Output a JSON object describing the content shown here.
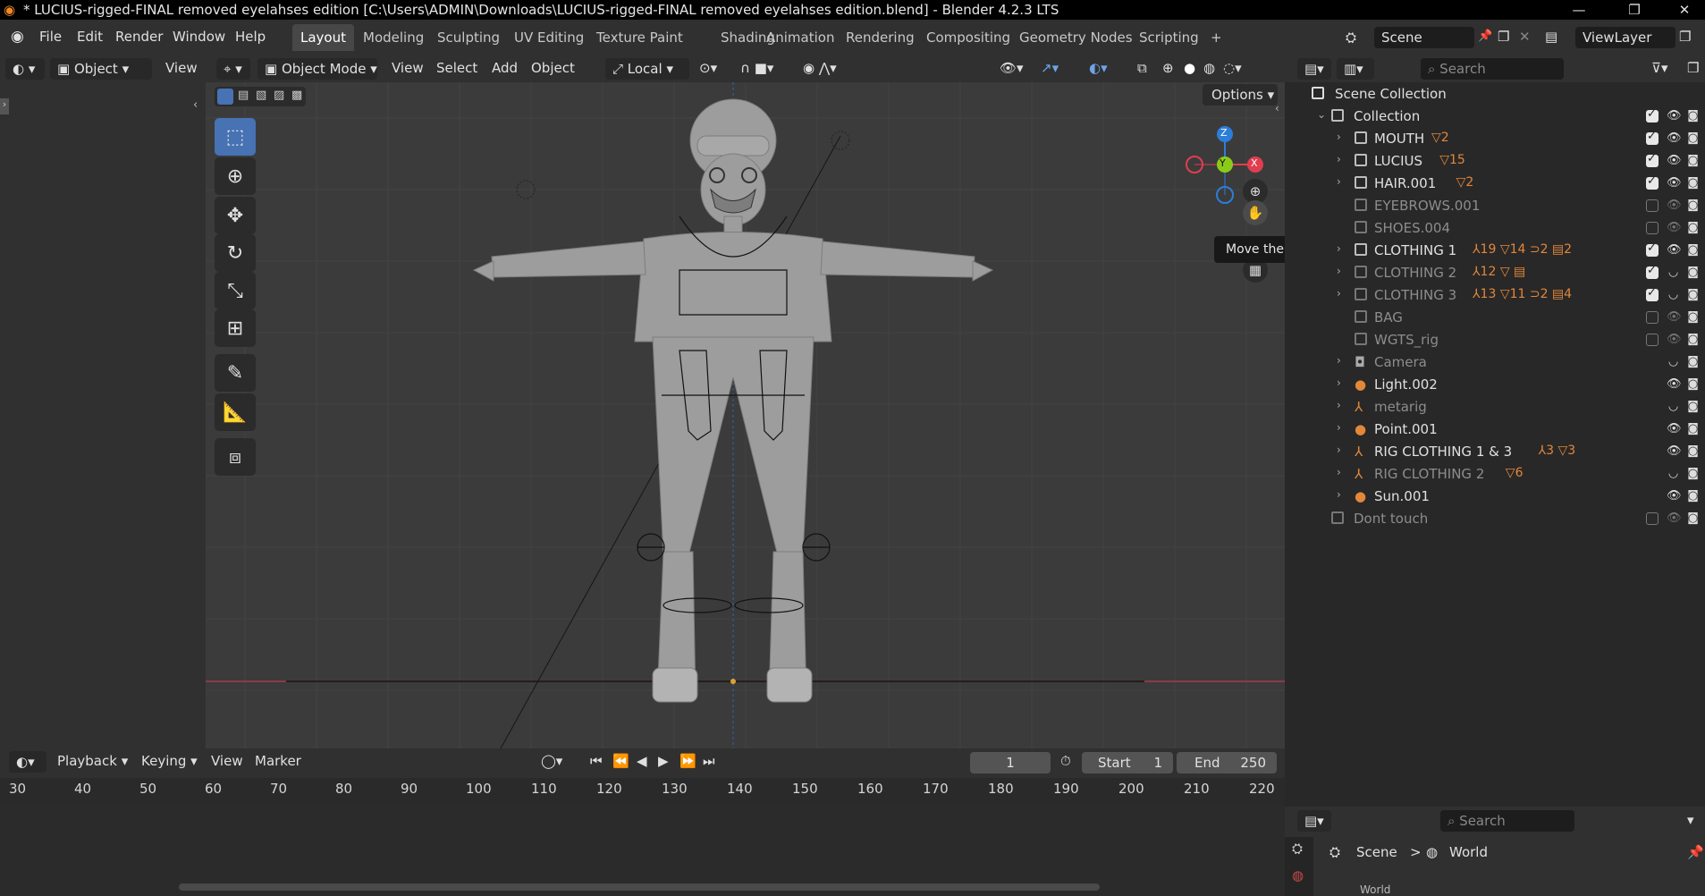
{
  "window": {
    "title": "* LUCIUS-rigged-FINAL removed eyelahses edition [C:\\Users\\ADMIN\\Downloads\\LUCIUS-rigged-FINAL removed eyelahses edition.blend] - Blender 4.2.3 LTS",
    "controls": {
      "minimize": "—",
      "maximize": "❐",
      "close": "✕"
    }
  },
  "menubar": {
    "items": [
      "File",
      "Edit",
      "Render",
      "Window",
      "Help"
    ],
    "workspaces": [
      "Layout",
      "Modeling",
      "Sculpting",
      "UV Editing",
      "Texture Paint",
      "Shading",
      "Animation",
      "Rendering",
      "Compositing",
      "Geometry Nodes",
      "Scripting"
    ],
    "active_workspace": "Layout",
    "add_tab": "+",
    "scene": "Scene",
    "view_layer": "ViewLayer"
  },
  "left_panel": {
    "mode_dropdown": "Object",
    "view_menu": "View"
  },
  "viewport_header": {
    "mode": "Object Mode",
    "menus": [
      "View",
      "Select",
      "Add",
      "Object"
    ],
    "transform_orientation": "Local",
    "options_label": "Options"
  },
  "viewport": {
    "tooltip": "Move the view",
    "gizmo_axes": {
      "z": "Z",
      "y": "Y",
      "x": "X"
    },
    "colors": {
      "x_axis": "#e03e50",
      "y_axis": "#8acb1a",
      "z_axis": "#2d7ed8",
      "active_tool": "#4772b3"
    }
  },
  "outliner": {
    "search_placeholder": "Search",
    "root": "Scene Collection",
    "collection": "Collection",
    "rows": [
      {
        "name": "MOUTH",
        "extra": "▽2",
        "dim": false,
        "checked": true
      },
      {
        "name": "LUCIUS",
        "extra": "▽15",
        "dim": false,
        "checked": true
      },
      {
        "name": "HAIR.001",
        "extra": "▽2",
        "dim": false,
        "checked": true
      },
      {
        "name": "EYEBROWS.001",
        "extra": "",
        "dim": true,
        "checked": false
      },
      {
        "name": "SHOES.004",
        "extra": "",
        "dim": true,
        "checked": false
      },
      {
        "name": "CLOTHING 1",
        "extra": "⅄19 ▽14 ⊃2 ▤2",
        "dim": false,
        "checked": true
      },
      {
        "name": "CLOTHING 2",
        "extra": "⅄12 ▽ ▤",
        "dim": true,
        "checked": true
      },
      {
        "name": "CLOTHING 3",
        "extra": "⅄13 ▽11 ⊃2 ▤4",
        "dim": true,
        "checked": true
      },
      {
        "name": "BAG",
        "extra": "",
        "dim": true,
        "checked": false
      },
      {
        "name": "WGTS_rig",
        "extra": "",
        "dim": true,
        "checked": false
      },
      {
        "name": "Camera",
        "extra": "",
        "dim": true,
        "checked": null
      },
      {
        "name": "Light.002",
        "extra": "",
        "dim": false,
        "checked": null
      },
      {
        "name": "metarig",
        "extra": "",
        "dim": true,
        "checked": null
      },
      {
        "name": "Point.001",
        "extra": "",
        "dim": false,
        "checked": null
      },
      {
        "name": "RIG CLOTHING 1 & 3",
        "extra": "⅄3 ▽3",
        "dim": false,
        "checked": null
      },
      {
        "name": "RIG CLOTHING 2",
        "extra": "▽6",
        "dim": true,
        "checked": null
      },
      {
        "name": "Sun.001",
        "extra": "",
        "dim": false,
        "checked": null
      },
      {
        "name": "Dont touch",
        "extra": "",
        "dim": true,
        "checked": false
      }
    ]
  },
  "properties": {
    "search_placeholder": "Search",
    "breadcrumb": [
      "Scene",
      "World"
    ],
    "separator": ">",
    "partial_label": "World"
  },
  "timeline": {
    "menus": [
      "Playback",
      "Keying",
      "View",
      "Marker"
    ],
    "current_frame": "1",
    "start_label": "Start",
    "start_value": "1",
    "end_label": "End",
    "end_value": "250",
    "ticks": [
      "30",
      "40",
      "50",
      "60",
      "70",
      "80",
      "90",
      "100",
      "110",
      "120",
      "130",
      "140",
      "150",
      "160",
      "170",
      "180",
      "190",
      "200",
      "210",
      "220"
    ]
  }
}
